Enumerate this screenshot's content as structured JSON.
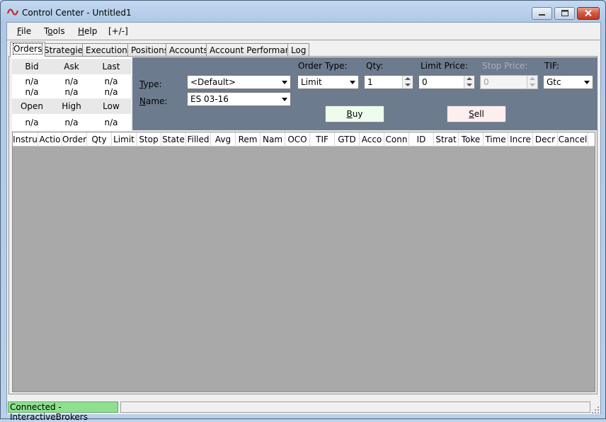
{
  "window": {
    "title": "Control Center - Untitled1"
  },
  "menu": {
    "file": {
      "accel": "F",
      "rest": "ile"
    },
    "tools": {
      "pre": "T",
      "accel": "o",
      "rest": "ols"
    },
    "help": {
      "accel": "H",
      "rest": "elp"
    },
    "toggle": "[+/-]"
  },
  "tabs": [
    "Orders",
    "Strategies",
    "Executions",
    "Positions",
    "Accounts",
    "Account Performance",
    "Log"
  ],
  "quote": {
    "headers1": [
      "Bid",
      "Ask",
      "Last"
    ],
    "rows1": [
      [
        "n/a",
        "n/a",
        "n/a"
      ],
      [
        "n/a",
        "n/a",
        "n/a"
      ]
    ],
    "headers2": [
      "Open",
      "High",
      "Low"
    ],
    "rows2": [
      [
        "n/a",
        "n/a",
        "n/a"
      ]
    ]
  },
  "order_entry": {
    "type_label": {
      "accel": "T",
      "rest": "ype:"
    },
    "name_label": {
      "accel": "N",
      "rest": "ame:"
    },
    "type_value": "<Default>",
    "name_value": "ES 03-16",
    "order_type_label": "Order Type:",
    "order_type_value": "Limit",
    "qty_label": "Qty:",
    "qty_value": "1",
    "limit_price_label": "Limit Price:",
    "limit_price_value": "0",
    "stop_price_label": "Stop Price:",
    "stop_price_value": "0",
    "tif_label": "TIF:",
    "tif_value": "Gtc",
    "buy": {
      "accel": "B",
      "rest": "uy"
    },
    "sell": {
      "accel": "S",
      "rest": "ell"
    }
  },
  "grid": {
    "columns": [
      "Instru",
      "Actio",
      "Order",
      "Qty",
      "Limit",
      "Stop",
      "State",
      "Filled",
      "Avg",
      "Rem",
      "Nam",
      "OCO",
      "TIF",
      "GTD",
      "Acco",
      "Conn",
      "ID",
      "Strat",
      "Toke",
      "Time",
      "Incre",
      "Decr",
      "Cancel"
    ]
  },
  "status": {
    "connection": "Connected - InteractiveBrokers"
  },
  "colors": {
    "connected": "#8ee08e",
    "order_panel": "#6d7b8e",
    "grid_bg": "#a9a9a9"
  }
}
